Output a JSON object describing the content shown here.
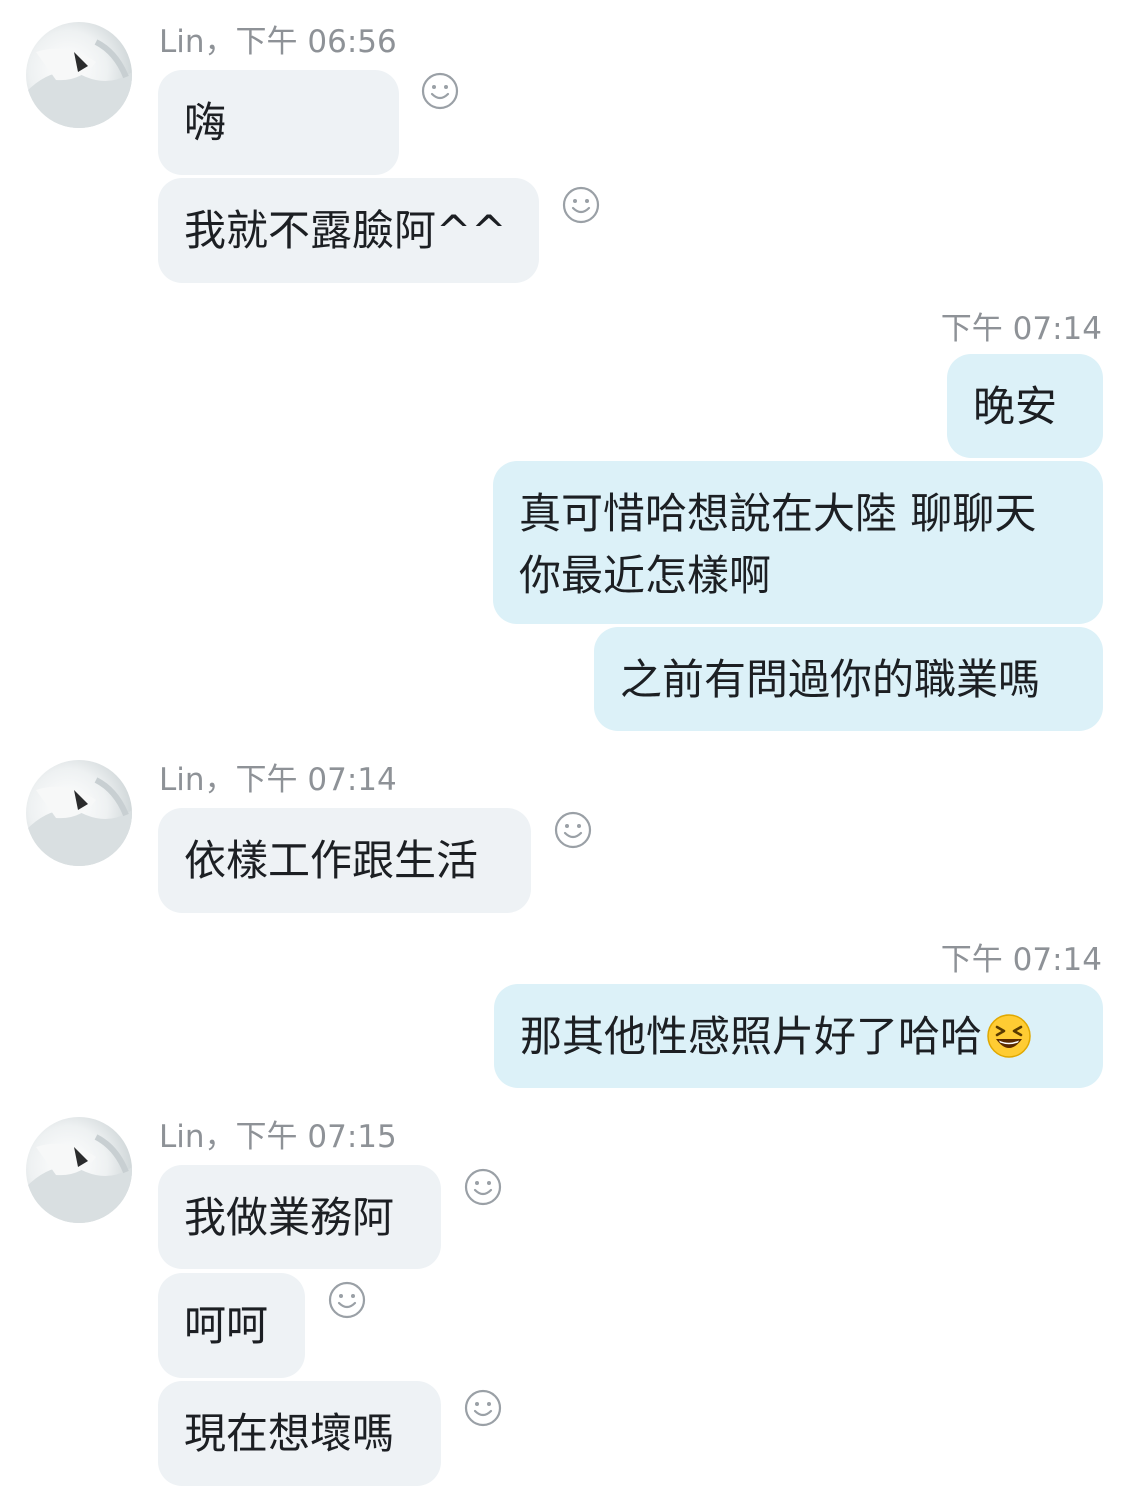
{
  "messages": {
    "g1": {
      "meta": "Lin，下午 06:56",
      "m1": "嗨",
      "m2": "我就不露臉阿^^"
    },
    "g2": {
      "meta": "下午 07:14",
      "m1": "晚安",
      "m2_line1": "真可惜哈想說在大陸 聊聊天",
      "m2_line2": "你最近怎樣啊",
      "m3": "之前有問過你的職業嗎"
    },
    "g3": {
      "meta": "Lin，下午 07:14",
      "m1": "依樣工作跟生活"
    },
    "g4": {
      "meta": "下午 07:14",
      "m1": "那其他性感照片好了哈哈"
    },
    "g5": {
      "meta": "Lin，下午 07:15",
      "m1": "我做業務阿",
      "m2": "呵呵",
      "m3": "現在想壞嗎"
    }
  },
  "icons": {
    "reaction": "smiley-reaction-icon",
    "emoji": "grinning-squinting-face-emoji",
    "avatar": "user-avatar"
  },
  "colors": {
    "incoming_bubble": "#eef2f5",
    "outgoing_bubble": "#dcf1f8",
    "meta_text": "#8e9297"
  }
}
